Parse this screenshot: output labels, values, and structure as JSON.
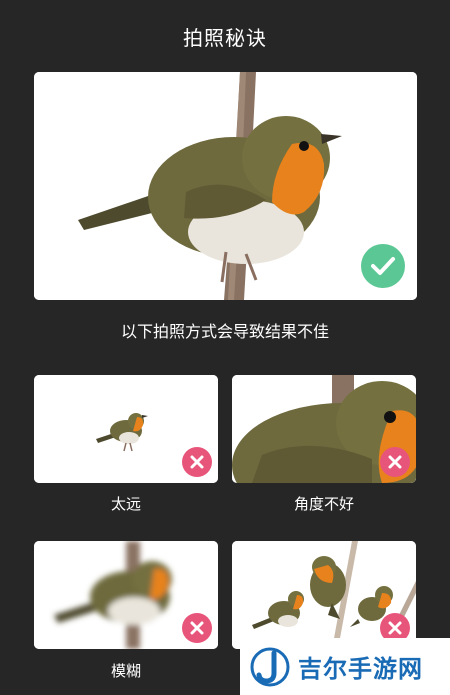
{
  "header": {
    "title": "拍照秘诀"
  },
  "good_example": {
    "status_icon": "check-icon",
    "accent": "#5bc795"
  },
  "notice": {
    "text": "以下拍照方式会导致结果不佳"
  },
  "bad_examples": [
    {
      "label": "太远",
      "status_icon": "close-icon"
    },
    {
      "label": "角度不好",
      "status_icon": "close-icon"
    },
    {
      "label": "模糊",
      "status_icon": "close-icon"
    },
    {
      "label": "",
      "status_icon": "close-icon"
    }
  ],
  "colors": {
    "background": "#262626",
    "error": "#e8557a",
    "ok": "#5bc795",
    "watermark": "#1a6bb5"
  },
  "watermark": {
    "text": "吉尔手游网",
    "logo": "j-logo-icon"
  }
}
